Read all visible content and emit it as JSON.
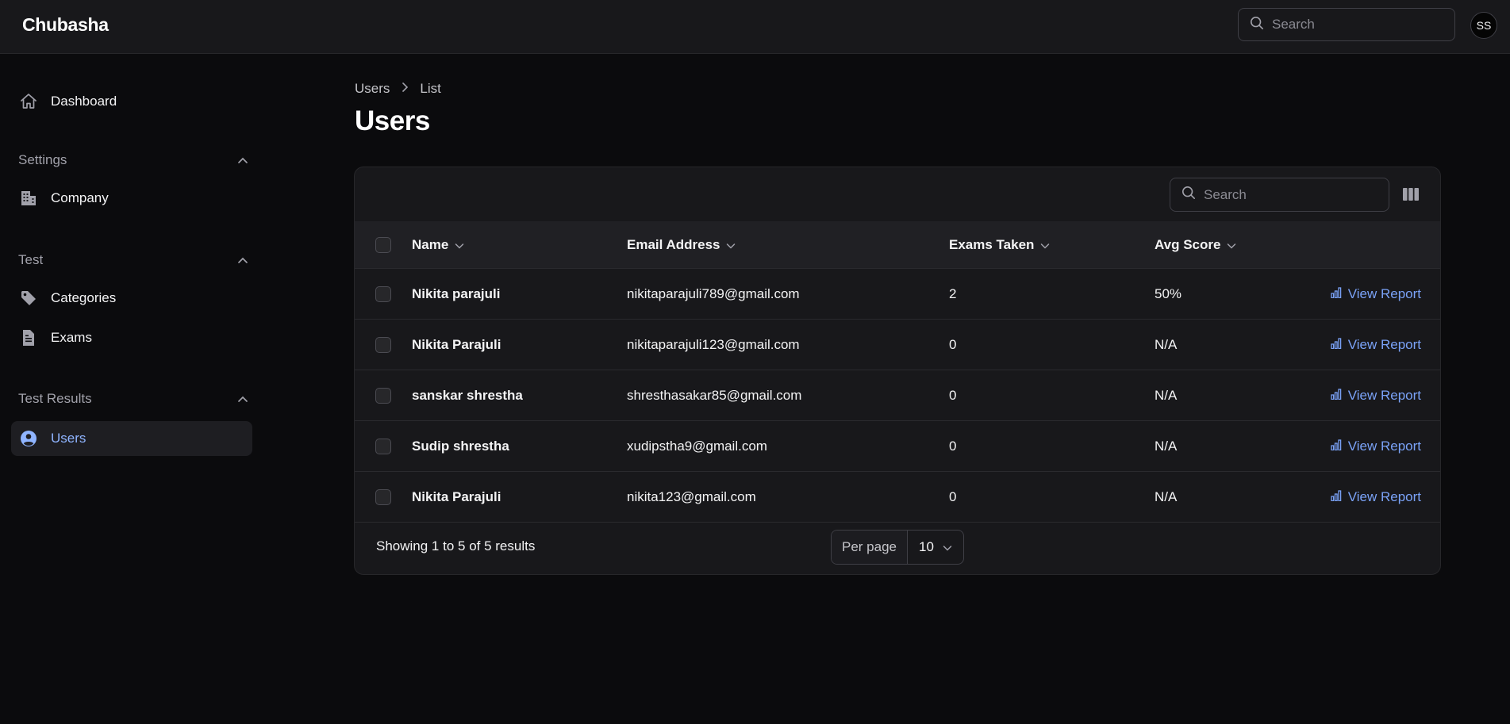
{
  "app": {
    "brand": "Chubasha",
    "avatar_initials": "SS"
  },
  "header": {
    "search_placeholder": "Search"
  },
  "sidebar": {
    "dashboard": "Dashboard",
    "groups": [
      {
        "label": "Settings",
        "items": [
          "Company"
        ]
      },
      {
        "label": "Test",
        "items": [
          "Categories",
          "Exams"
        ]
      },
      {
        "label": "Test Results",
        "items": [
          "Users"
        ]
      }
    ],
    "active_item": "Users"
  },
  "breadcrumb": {
    "parent": "Users",
    "current": "List"
  },
  "page": {
    "title": "Users"
  },
  "table": {
    "search_placeholder": "Search",
    "columns": [
      "Name",
      "Email Address",
      "Exams Taken",
      "Avg Score"
    ],
    "action_label": "View Report",
    "rows": [
      {
        "name": "Nikita parajuli",
        "email": "nikitaparajuli789@gmail.com",
        "exams": "2",
        "score": "50%"
      },
      {
        "name": "Nikita Parajuli",
        "email": "nikitaparajuli123@gmail.com",
        "exams": "0",
        "score": "N/A"
      },
      {
        "name": "sanskar shrestha",
        "email": "shresthasakar85@gmail.com",
        "exams": "0",
        "score": "N/A"
      },
      {
        "name": "Sudip shrestha",
        "email": "xudipstha9@gmail.com",
        "exams": "0",
        "score": "N/A"
      },
      {
        "name": "Nikita Parajuli",
        "email": "nikita123@gmail.com",
        "exams": "0",
        "score": "N/A"
      }
    ],
    "footer": {
      "summary": "Showing 1 to 5 of 5 results",
      "per_page_label": "Per page",
      "per_page_value": "10"
    }
  },
  "colors": {
    "accent": "#7aa2f7",
    "background": "#0b0b0d",
    "surface": "#18181b"
  }
}
